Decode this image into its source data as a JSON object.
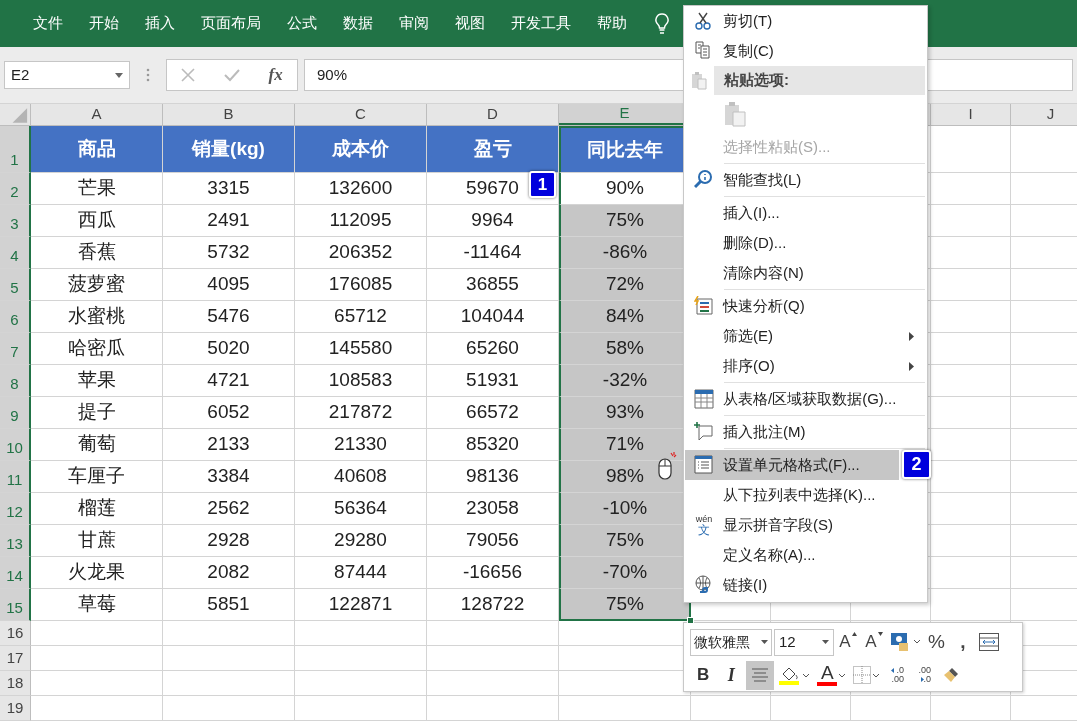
{
  "ribbon": {
    "tabs": [
      "文件",
      "开始",
      "插入",
      "页面布局",
      "公式",
      "数据",
      "审阅",
      "视图",
      "开发工具",
      "帮助"
    ]
  },
  "formula_bar": {
    "name_box": "E2",
    "fx": "fx",
    "value": "90%"
  },
  "column_headers": [
    {
      "label": "A",
      "selected": false
    },
    {
      "label": "B",
      "selected": false
    },
    {
      "label": "C",
      "selected": false
    },
    {
      "label": "D",
      "selected": false
    },
    {
      "label": "E",
      "selected": true
    },
    {
      "label": "I",
      "selected": false
    },
    {
      "label": "J",
      "selected": false
    }
  ],
  "sheet": {
    "header": [
      "商品",
      "销量(kg)",
      "成本价",
      "盈亏",
      "同比去年"
    ],
    "rows": [
      {
        "cells": [
          "芒果",
          "3315",
          "132600",
          "59670",
          "90%"
        ],
        "selected": false
      },
      {
        "cells": [
          "西瓜",
          "2491",
          "112095",
          "9964",
          "75%"
        ],
        "selected": true
      },
      {
        "cells": [
          "香蕉",
          "5732",
          "206352",
          "-11464",
          "-86%"
        ],
        "selected": true
      },
      {
        "cells": [
          "菠萝蜜",
          "4095",
          "176085",
          "36855",
          "72%"
        ],
        "selected": true
      },
      {
        "cells": [
          "水蜜桃",
          "5476",
          "65712",
          "104044",
          "84%"
        ],
        "selected": true
      },
      {
        "cells": [
          "哈密瓜",
          "5020",
          "145580",
          "65260",
          "58%"
        ],
        "selected": true
      },
      {
        "cells": [
          "苹果",
          "4721",
          "108583",
          "51931",
          "-32%"
        ],
        "selected": true
      },
      {
        "cells": [
          "提子",
          "6052",
          "217872",
          "66572",
          "93%"
        ],
        "selected": true
      },
      {
        "cells": [
          "葡萄",
          "2133",
          "21330",
          "85320",
          "71%"
        ],
        "selected": true
      },
      {
        "cells": [
          "车厘子",
          "3384",
          "40608",
          "98136",
          "98%"
        ],
        "selected": true
      },
      {
        "cells": [
          "榴莲",
          "2562",
          "56364",
          "23058",
          "-10%"
        ],
        "selected": true
      },
      {
        "cells": [
          "甘蔗",
          "2928",
          "29280",
          "79056",
          "75%"
        ],
        "selected": true
      },
      {
        "cells": [
          "火龙果",
          "2082",
          "87444",
          "-16656",
          "-70%"
        ],
        "selected": true
      },
      {
        "cells": [
          "草莓",
          "5851",
          "122871",
          "128722",
          "75%"
        ],
        "selected": true
      }
    ]
  },
  "row_numbers": [
    {
      "label": "1",
      "selected": true
    },
    {
      "label": "2",
      "selected": true
    },
    {
      "label": "3",
      "selected": true
    },
    {
      "label": "4",
      "selected": true
    },
    {
      "label": "5",
      "selected": true
    },
    {
      "label": "6",
      "selected": true
    },
    {
      "label": "7",
      "selected": true
    },
    {
      "label": "8",
      "selected": true
    },
    {
      "label": "9",
      "selected": true
    },
    {
      "label": "10",
      "selected": true
    },
    {
      "label": "11",
      "selected": true
    },
    {
      "label": "12",
      "selected": true
    },
    {
      "label": "13",
      "selected": true
    },
    {
      "label": "14",
      "selected": true
    },
    {
      "label": "15",
      "selected": true
    },
    {
      "label": "16",
      "selected": false
    },
    {
      "label": "17",
      "selected": false
    },
    {
      "label": "18",
      "selected": false
    },
    {
      "label": "19",
      "selected": false
    }
  ],
  "context_menu": {
    "items": [
      {
        "kind": "item",
        "label": "剪切(T)",
        "disabled": false,
        "submenu": false,
        "selected": false
      },
      {
        "kind": "item",
        "label": "复制(C)",
        "disabled": false,
        "submenu": false,
        "selected": false
      },
      {
        "kind": "header",
        "label": "粘贴选项:"
      },
      {
        "kind": "paste_icons"
      },
      {
        "kind": "item",
        "label": "选择性粘贴(S)...",
        "disabled": true,
        "submenu": false,
        "selected": false
      },
      {
        "kind": "separator"
      },
      {
        "kind": "item",
        "label": "智能查找(L)",
        "disabled": false,
        "submenu": false,
        "selected": false
      },
      {
        "kind": "separator"
      },
      {
        "kind": "item",
        "label": "插入(I)...",
        "disabled": false,
        "submenu": false,
        "selected": false
      },
      {
        "kind": "item",
        "label": "删除(D)...",
        "disabled": false,
        "submenu": false,
        "selected": false
      },
      {
        "kind": "item",
        "label": "清除内容(N)",
        "disabled": false,
        "submenu": false,
        "selected": false
      },
      {
        "kind": "separator"
      },
      {
        "kind": "item",
        "label": "快速分析(Q)",
        "disabled": false,
        "submenu": false,
        "selected": false
      },
      {
        "kind": "item",
        "label": "筛选(E)",
        "disabled": false,
        "submenu": true,
        "selected": false
      },
      {
        "kind": "item",
        "label": "排序(O)",
        "disabled": false,
        "submenu": true,
        "selected": false
      },
      {
        "kind": "separator"
      },
      {
        "kind": "item",
        "label": "从表格/区域获取数据(G)...",
        "disabled": false,
        "submenu": false,
        "selected": false
      },
      {
        "kind": "separator"
      },
      {
        "kind": "item",
        "label": "插入批注(M)",
        "disabled": false,
        "submenu": false,
        "selected": false
      },
      {
        "kind": "separator"
      },
      {
        "kind": "item",
        "label": "设置单元格格式(F)...",
        "disabled": false,
        "submenu": false,
        "selected": true
      },
      {
        "kind": "item",
        "label": "从下拉列表中选择(K)...",
        "disabled": false,
        "submenu": false,
        "selected": false
      },
      {
        "kind": "item",
        "label": "显示拼音字段(S)",
        "disabled": false,
        "submenu": false,
        "selected": false,
        "icon_text": [
          "wén",
          "文"
        ]
      },
      {
        "kind": "item",
        "label": "定义名称(A)...",
        "disabled": false,
        "submenu": false,
        "selected": false
      },
      {
        "kind": "item",
        "label": "链接(I)",
        "disabled": false,
        "submenu": false,
        "selected": false
      }
    ]
  },
  "mini_toolbar": {
    "font": "微软雅黑",
    "size": "12",
    "row1": [
      {
        "kind": "grow",
        "label": "A",
        "selected": false
      },
      {
        "kind": "shrink",
        "label": "A",
        "selected": false
      },
      {
        "kind": "accounting",
        "selected": false
      },
      {
        "kind": "percent",
        "label": "%",
        "selected": false
      },
      {
        "kind": "comma",
        "label": ",",
        "selected": false
      },
      {
        "kind": "merge",
        "selected": false
      }
    ],
    "row2": [
      {
        "kind": "bold",
        "label": "B",
        "selected": false
      },
      {
        "kind": "italic",
        "label": "I",
        "selected": false
      },
      {
        "kind": "align",
        "selected": true
      },
      {
        "kind": "fill",
        "color": "#ffff00",
        "selected": false
      },
      {
        "kind": "font_color",
        "label": "A",
        "color": "#ff0000",
        "selected": false
      },
      {
        "kind": "borders",
        "selected": false
      },
      {
        "kind": "inc_decimal",
        "labels": [
          ".0",
          ".00"
        ],
        "selected": false
      },
      {
        "kind": "dec_decimal",
        "labels": [
          ".00",
          ".0"
        ],
        "selected": false
      },
      {
        "kind": "painter",
        "selected": false
      }
    ]
  },
  "badges": [
    "1",
    "2"
  ]
}
